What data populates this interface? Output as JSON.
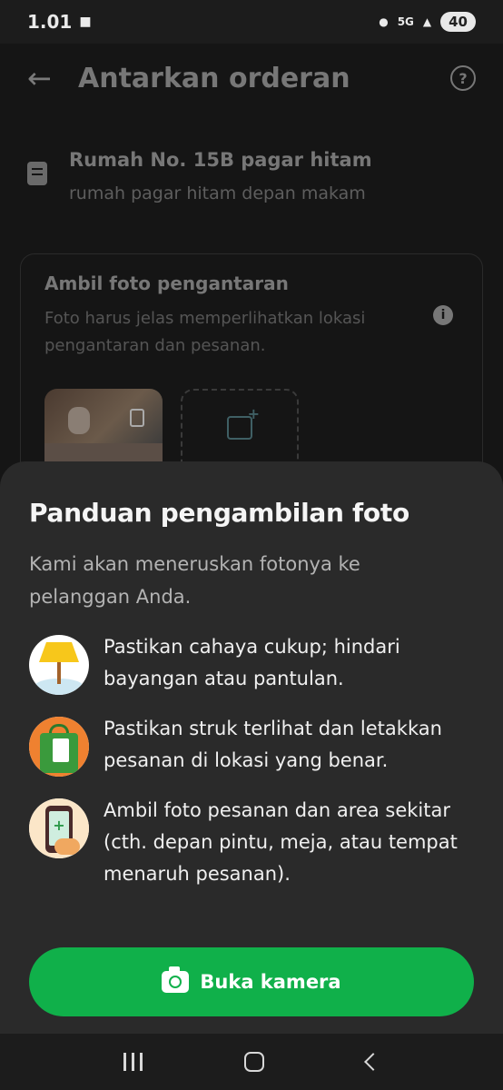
{
  "status_bar": {
    "time": "1.01",
    "network": "5G",
    "battery": "40"
  },
  "header": {
    "title": "Antarkan orderan",
    "back_icon": "back-arrow-icon",
    "help_icon": "help-icon"
  },
  "address": {
    "title": "Rumah No. 15B pagar hitam",
    "note": "rumah pagar hitam depan makam"
  },
  "photo_card": {
    "title": "Ambil foto pengantaran",
    "description": "Foto harus jelas memperlihatkan lokasi pengantaran dan pesanan."
  },
  "sheet": {
    "title": "Panduan pengambilan foto",
    "subtitle": "Kami akan meneruskan fotonya ke pelanggan Anda.",
    "guides": [
      {
        "icon": "lamp-icon",
        "text": "Pastikan cahaya cukup; hindari bayangan atau pantulan."
      },
      {
        "icon": "shopping-bag-icon",
        "text": "Pastikan struk terlihat dan letakkan pesanan di lokasi yang benar."
      },
      {
        "icon": "phone-camera-icon",
        "text": "Ambil foto pesanan dan area sekitar (cth. depan pintu, meja, atau tempat menaruh pesanan)."
      }
    ],
    "button_label": "Buka kamera"
  },
  "colors": {
    "accent": "#10b04a",
    "sheet_bg": "#2a2a2a"
  }
}
